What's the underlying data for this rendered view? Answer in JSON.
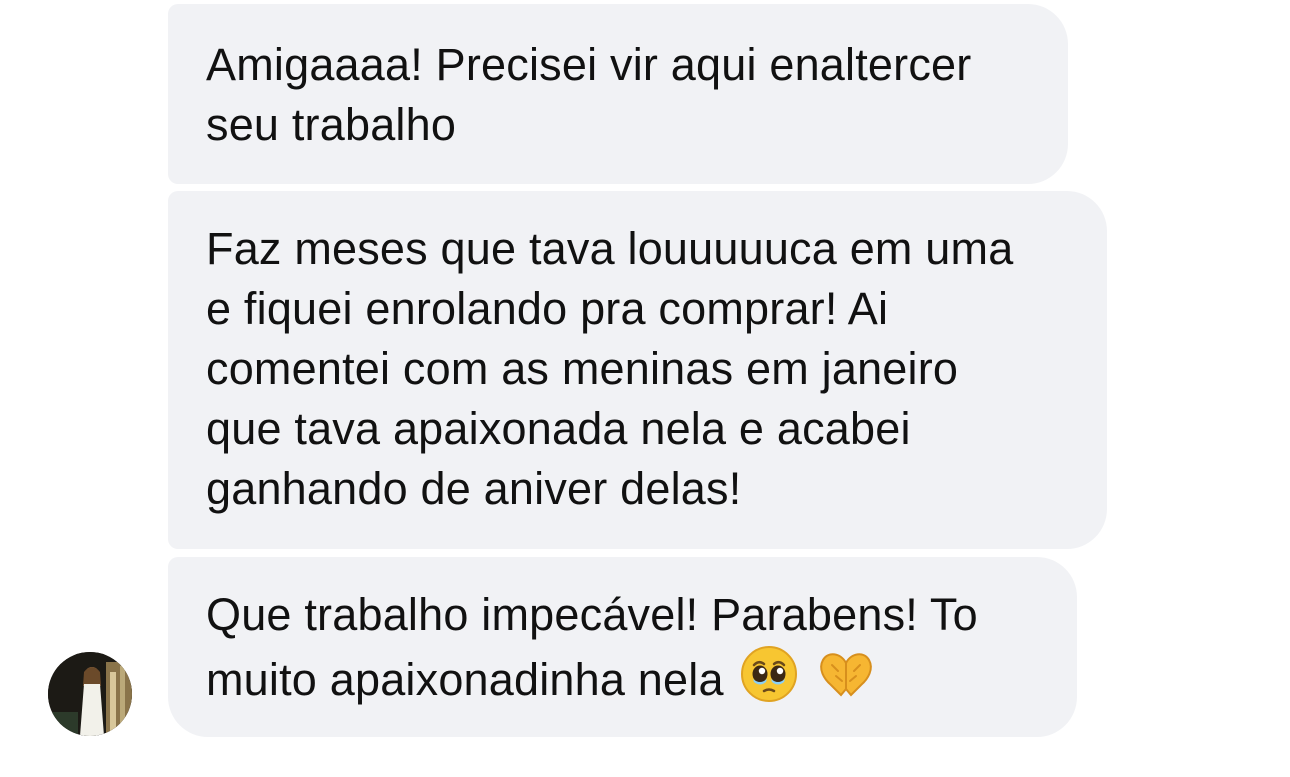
{
  "messages": [
    {
      "lines": [
        "Amigaaaa! Precisei vir aqui enaltercer",
        "seu trabalho"
      ]
    },
    {
      "lines": [
        "Faz meses que tava louuuuuca em uma",
        "e fiquei enrolando pra comprar! Ai",
        "comentei com as meninas em janeiro",
        "que tava apaixonada nela e acabei",
        "ganhando de aniver delas!"
      ]
    },
    {
      "lines": [
        "Que trabalho impecável! Parabens! To",
        "muito apaixonadinha nela"
      ],
      "emojis": [
        "pleading-face-emoji",
        "heart-hands-emoji"
      ]
    }
  ],
  "colors": {
    "bubble": "#f1f2f5",
    "text": "#111111",
    "emoji_yellow": "#f7b928"
  }
}
